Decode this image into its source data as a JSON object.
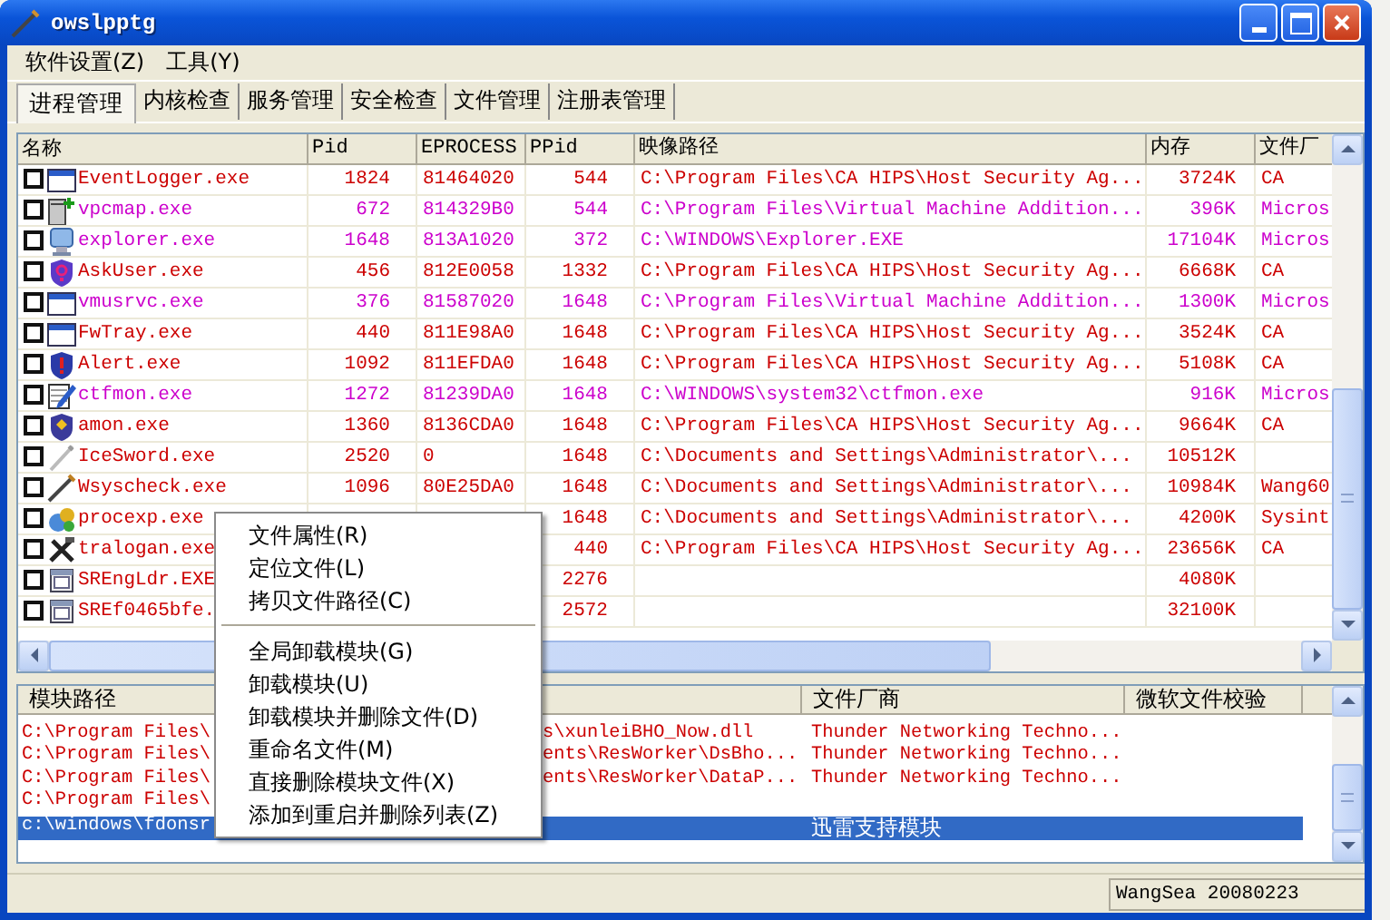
{
  "window": {
    "title": "owslpptg"
  },
  "menu": [
    "软件设置(Z)",
    "工具(Y)"
  ],
  "tabs": [
    {
      "label": "进程管理",
      "selected": true
    },
    {
      "label": "内核检查",
      "selected": false
    },
    {
      "label": "服务管理",
      "selected": false
    },
    {
      "label": "安全检查",
      "selected": false
    },
    {
      "label": "文件管理",
      "selected": false
    },
    {
      "label": "注册表管理",
      "selected": false
    }
  ],
  "process_table": {
    "columns": [
      "名称",
      "Pid",
      "EPROCESS",
      "PPid",
      "映像路径",
      "内存",
      "文件厂"
    ],
    "rows": [
      {
        "checked": false,
        "color": "#cc0000",
        "name": "EventLogger.exe",
        "pid": "1824",
        "eprocess": "81464020",
        "ppid": "544",
        "path": "C:\\Program Files\\CA HIPS\\Host Security Ag...",
        "memory": "3724K",
        "vendor": "CA"
      },
      {
        "checked": false,
        "color": "#cc00cc",
        "name": "vpcmap.exe",
        "pid": "672",
        "eprocess": "814329B0",
        "ppid": "544",
        "path": "C:\\Program Files\\Virtual Machine Addition...",
        "memory": "396K",
        "vendor": "Micros"
      },
      {
        "checked": false,
        "color": "#cc00cc",
        "name": "explorer.exe",
        "pid": "1648",
        "eprocess": "813A1020",
        "ppid": "372",
        "path": "C:\\WINDOWS\\Explorer.EXE",
        "memory": "17104K",
        "vendor": "Micros"
      },
      {
        "checked": false,
        "color": "#cc0000",
        "name": "AskUser.exe",
        "pid": "456",
        "eprocess": "812E0058",
        "ppid": "1332",
        "path": "C:\\Program Files\\CA HIPS\\Host Security Ag...",
        "memory": "6668K",
        "vendor": "CA"
      },
      {
        "checked": false,
        "color": "#cc00cc",
        "name": "vmusrvc.exe",
        "pid": "376",
        "eprocess": "81587020",
        "ppid": "1648",
        "path": "C:\\Program Files\\Virtual Machine Addition...",
        "memory": "1300K",
        "vendor": "Micros"
      },
      {
        "checked": false,
        "color": "#cc0000",
        "name": "FwTray.exe",
        "pid": "440",
        "eprocess": "811E98A0",
        "ppid": "1648",
        "path": "C:\\Program Files\\CA HIPS\\Host Security Ag...",
        "memory": "3524K",
        "vendor": "CA"
      },
      {
        "checked": false,
        "color": "#cc0000",
        "name": "Alert.exe",
        "pid": "1092",
        "eprocess": "811EFDA0",
        "ppid": "1648",
        "path": "C:\\Program Files\\CA HIPS\\Host Security Ag...",
        "memory": "5108K",
        "vendor": "CA"
      },
      {
        "checked": false,
        "color": "#cc00cc",
        "name": "ctfmon.exe",
        "pid": "1272",
        "eprocess": "81239DA0",
        "ppid": "1648",
        "path": "C:\\WINDOWS\\system32\\ctfmon.exe",
        "memory": "916K",
        "vendor": "Micros"
      },
      {
        "checked": false,
        "color": "#cc0000",
        "name": "amon.exe",
        "pid": "1360",
        "eprocess": "8136CDA0",
        "ppid": "1648",
        "path": "C:\\Program Files\\CA HIPS\\Host Security Ag...",
        "memory": "9664K",
        "vendor": "CA"
      },
      {
        "checked": false,
        "color": "#cc0000",
        "name": "IceSword.exe",
        "pid": "2520",
        "eprocess": "0",
        "ppid": "1648",
        "path": "C:\\Documents and Settings\\Administrator\\...",
        "memory": "10512K"
      },
      {
        "checked": false,
        "color": "#cc0000",
        "name": "Wsyscheck.exe",
        "pid": "1096",
        "eprocess": "80E25DA0",
        "ppid": "1648",
        "path": "C:\\Documents and Settings\\Administrator\\...",
        "memory": "10984K",
        "vendor": "Wang60"
      },
      {
        "checked": false,
        "color": "#cc0000",
        "name": "procexp.exe",
        "ppid": "1648",
        "path": "C:\\Documents and Settings\\Administrator\\...",
        "memory": "4200K",
        "vendor": "Sysint"
      },
      {
        "checked": false,
        "color": "#cc0000",
        "name": "tralogan.exe",
        "ppid": "440",
        "path": "C:\\Program Files\\CA HIPS\\Host Security Ag...",
        "memory": "23656K",
        "vendor": "CA"
      },
      {
        "checked": false,
        "color": "#cc0000",
        "name": "SREngLdr.EXE",
        "ppid": "2276",
        "memory": "4080K"
      },
      {
        "checked": false,
        "color": "#cc0000",
        "name": "SREf0465bfe.",
        "ppid": "2572",
        "memory": "32100K"
      }
    ]
  },
  "context_menu": [
    {
      "kind": "item",
      "label": "文件属性(R)"
    },
    {
      "kind": "item",
      "label": "定位文件(L)"
    },
    {
      "kind": "item",
      "label": "拷贝文件路径(C)"
    },
    {
      "kind": "separator"
    },
    {
      "kind": "item",
      "label": "全局卸载模块(G)"
    },
    {
      "kind": "item",
      "label": "卸载模块(U)"
    },
    {
      "kind": "item",
      "label": "卸载模块并删除文件(D)"
    },
    {
      "kind": "item",
      "label": "重命名文件(M)"
    },
    {
      "kind": "item",
      "label": "直接删除模块文件(X)"
    },
    {
      "kind": "item",
      "label": "添加到重启并删除列表(Z)"
    }
  ],
  "module_table": {
    "columns": [
      "模块路径",
      "文件厂商",
      "微软文件校验"
    ],
    "rows": [
      {
        "selected": false,
        "path_start": "C:\\Program Files\\",
        "path_end": "s\\xunleiBHO_Now.dll",
        "vendor": "Thunder Networking Techno..."
      },
      {
        "selected": false,
        "path_start": "C:\\Program Files\\",
        "path_end": "ents\\ResWorker\\DsBho...",
        "vendor": "Thunder Networking Techno..."
      },
      {
        "selected": false,
        "path_start": "C:\\Program Files\\",
        "path_end": "ents\\ResWorker\\DataP...",
        "vendor": "Thunder Networking Techno..."
      },
      {
        "selected": false,
        "path_start": "C:\\Program Files\\"
      },
      {
        "selected": true,
        "path_start": "c:\\windows\\fdonsr",
        "vendor": "迅雷支持模块"
      }
    ]
  },
  "status_bar": {
    "text": "WangSea 20080223"
  }
}
